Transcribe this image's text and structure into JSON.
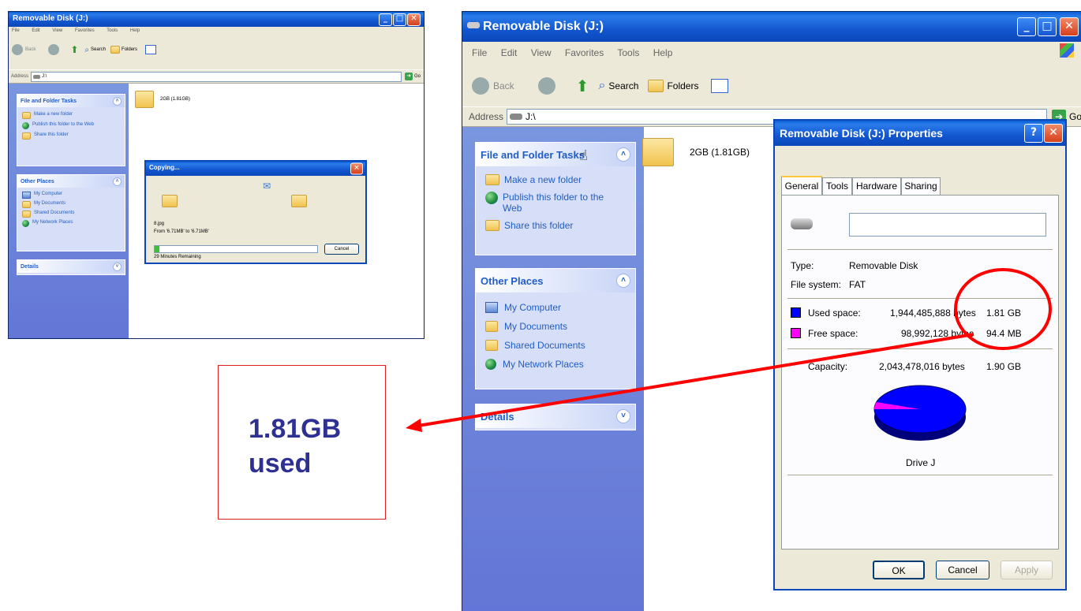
{
  "small_window": {
    "title": "Removable Disk (J:)",
    "menu": [
      "File",
      "Edit",
      "View",
      "Favorites",
      "Tools",
      "Help"
    ],
    "toolbar": {
      "back": "Back",
      "search": "Search",
      "folders": "Folders"
    },
    "address": {
      "label": "Address",
      "value": "J:\\",
      "go": "Go"
    },
    "panels": {
      "tasks": {
        "title": "File and Folder Tasks",
        "items": [
          "Make a new folder",
          "Publish this folder to the Web",
          "Share this folder"
        ]
      },
      "places": {
        "title": "Other Places",
        "items": [
          "My Computer",
          "My Documents",
          "Shared Documents",
          "My Network Places"
        ]
      },
      "details": {
        "title": "Details"
      }
    },
    "folder_label": "2GB (1.81GB)",
    "copy_dialog": {
      "title": "Copying...",
      "file": "8.jpg",
      "from_to": "From '6.71MB' to '6.71MB'",
      "progress": 0.03,
      "remaining": "29 Minutes Remaining",
      "cancel": "Cancel"
    }
  },
  "callout": {
    "text": "1.81GB used"
  },
  "big_window": {
    "title": "Removable Disk (J:)",
    "menu": [
      "File",
      "Edit",
      "View",
      "Favorites",
      "Tools",
      "Help"
    ],
    "toolbar": {
      "back": "Back",
      "search": "Search",
      "folders": "Folders"
    },
    "address": {
      "label": "Address",
      "value": "J:\\",
      "go": "Go"
    },
    "panels": {
      "tasks": {
        "title": "File and Folder Tasks",
        "items": [
          "Make a new folder",
          "Publish this folder to the Web",
          "Share this folder"
        ]
      },
      "places": {
        "title": "Other Places",
        "items": [
          "My Computer",
          "My Documents",
          "Shared Documents",
          "My Network Places"
        ]
      },
      "details": {
        "title": "Details"
      }
    },
    "folder_label": "2GB (1.81GB)"
  },
  "properties": {
    "title": "Removable Disk (J:) Properties",
    "help": "?",
    "tabs": [
      "General",
      "Tools",
      "Hardware",
      "Sharing"
    ],
    "name_value": "",
    "type_label": "Type:",
    "type_value": "Removable Disk",
    "fs_label": "File system:",
    "fs_value": "FAT",
    "used_label": "Used space:",
    "used_bytes": "1,944,485,888 bytes",
    "used_size": "1.81 GB",
    "free_label": "Free space:",
    "free_bytes": "98,992,128 bytes",
    "free_size": "94.4 MB",
    "cap_label": "Capacity:",
    "cap_bytes": "2,043,478,016 bytes",
    "cap_size": "1.90 GB",
    "drive_label": "Drive J",
    "used_fraction": 0.9516,
    "colors": {
      "used": "#0000ff",
      "free": "#ff00ff",
      "highlight": "#ff0000"
    },
    "buttons": {
      "ok": "OK",
      "cancel": "Cancel",
      "apply": "Apply"
    }
  }
}
